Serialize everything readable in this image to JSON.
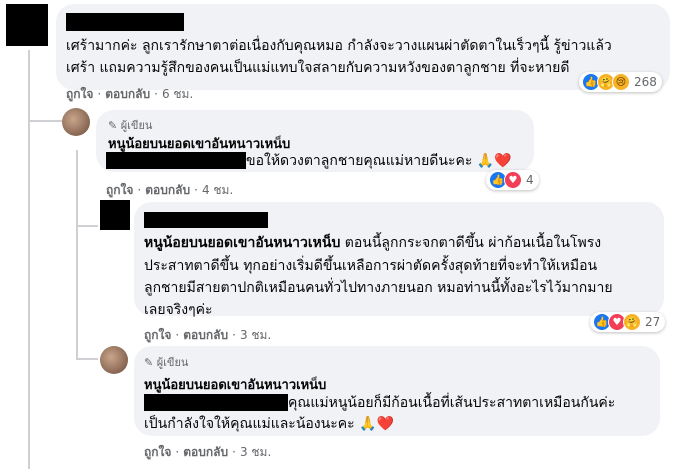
{
  "comment1": {
    "text_line1": "เศร้ามากค่ะ ลูกเรารักษาตาต่อเนื่องกับคุณหมอ กำลังจะวางแผนผ่าตัดตาในเร็วๆนี้ รู้ข่าวแล้ว",
    "text_line2": "เศร้า แถมความรู้สึกของคนเป็นแม่แทบใจสลายกับความหวังของตาลูกชาย ที่จะหายดี",
    "like": "ถูกใจ",
    "reply": "ตอบกลับ",
    "time": "6 ชม.",
    "reaction_count": "268"
  },
  "reply1": {
    "author_badge": "ผู้เขียน",
    "author": "หนูน้อยบนยอดเขาอันหนาวเหน็บ",
    "text": "ขอให้ดวงตาลูกชายคุณแม่หายดีนะคะ 🙏❤️",
    "like": "ถูกใจ",
    "reply": "ตอบกลับ",
    "time": "4 ชม.",
    "reaction_count": "4"
  },
  "reply2": {
    "mention": "หนูน้อยบนยอดเขาอันหนาวเหน็บ",
    "text_line1_rest": " ตอนนี้ลูกกระจกตาดีขึ้น ผ่าก้อนเนื้อในโพรง",
    "text_line2": "ประสาทตาดีขึ้น ทุกอย่างเริ่มดีขึ้นเหลือการผ่าตัดครั้งสุดท้ายที่จะทำให้เหมือน",
    "text_line3": "ลูกชายมีสายตาปกติเหมือนคนทั่วไปทางภายนอก หมอท่านนี้ทั้งอะไรไว้มากมาย",
    "text_line4": "เลยจริงๆค่ะ",
    "like": "ถูกใจ",
    "reply": "ตอบกลับ",
    "time": "3 ชม.",
    "reaction_count": "27"
  },
  "reply3": {
    "author_badge": "ผู้เขียน",
    "author": "หนูน้อยบนยอดเขาอันหนาวเหน็บ",
    "text_line1": "คุณแม่หนูน้อยก็มีก้อนเนื้อที่เส้นประสาทตาเหมือนกันค่ะ",
    "text_line2": "เป็นกำลังใจให้คุณแม่และน้องนะคะ 🙏❤️",
    "like": "ถูกใจ",
    "reply": "ตอบกลับ",
    "time": "3 ชม."
  }
}
